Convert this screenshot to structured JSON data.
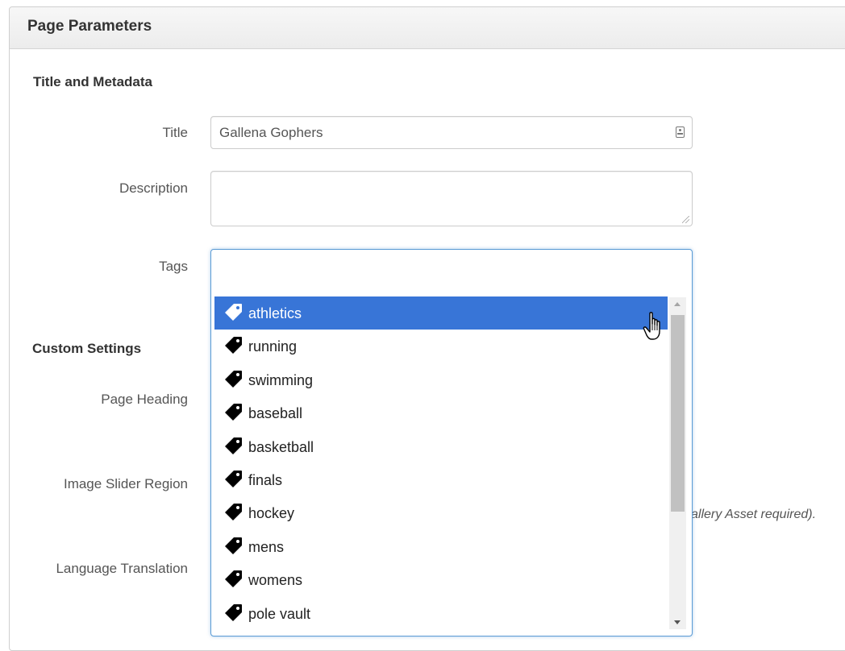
{
  "panel": {
    "title": "Page Parameters"
  },
  "sections": {
    "title_metadata": "Title and Metadata",
    "custom_settings": "Custom Settings"
  },
  "fields": {
    "title_label": "Title",
    "title_value": "Gallena Gophers",
    "description_label": "Description",
    "description_value": "",
    "tags_label": "Tags",
    "page_heading_label": "Page Heading",
    "image_slider_label": "Image Slider Region",
    "image_slider_note": "allery Asset required).",
    "language_label": "Language Translation"
  },
  "tags_dropdown": {
    "highlighted_index": 0,
    "options": [
      "athletics",
      "running",
      "swimming",
      "baseball",
      "basketball",
      "finals",
      "hockey",
      "mens",
      "womens",
      "pole vault"
    ]
  },
  "icons": {
    "tag_option": "tag-icon",
    "title_field": "contact-card-icon",
    "cursor": "hand-pointer-cursor-icon"
  },
  "colors": {
    "highlight": "#3875d7",
    "focus_border": "#5b9bd5",
    "scroll_thumb": "#c1c1c1"
  }
}
